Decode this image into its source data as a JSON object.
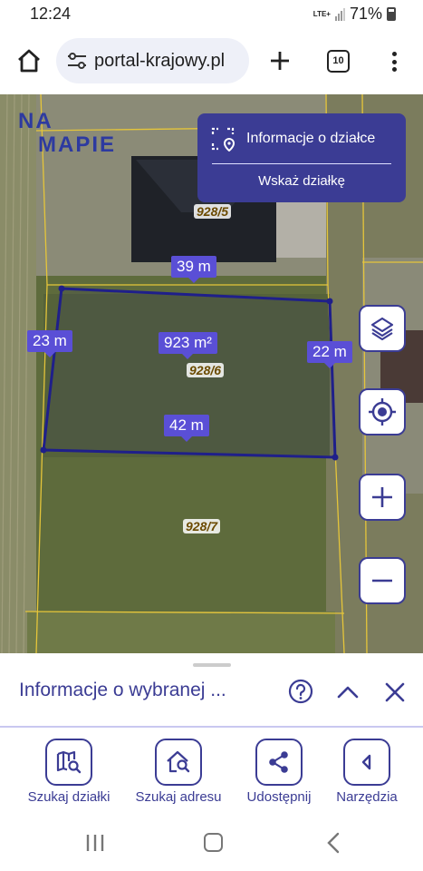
{
  "status_bar": {
    "time": "12:24",
    "network": "LTE+",
    "battery": "71%"
  },
  "browser": {
    "url": "portal-krajowy.pl",
    "tab_count": "10"
  },
  "map": {
    "logo_line1": "NA",
    "logo_line2": "MAPIE",
    "info_panel": {
      "title": "Informacje o działce",
      "action": "Wskaż działkę"
    },
    "parcels": [
      "928/5",
      "928/6",
      "928/7"
    ],
    "measurements": {
      "top": "39 m",
      "left": "23 m",
      "right": "22 m",
      "bottom": "42 m",
      "area": "923 m²"
    }
  },
  "sheet": {
    "title": "Informacje o wybranej ..."
  },
  "toolbar": [
    {
      "label": "Szukaj działki",
      "icon": "map-search-icon"
    },
    {
      "label": "Szukaj adresu",
      "icon": "home-search-icon"
    },
    {
      "label": "Udostępnij",
      "icon": "share-icon"
    },
    {
      "label": "Narzędzia",
      "icon": "tools-icon"
    }
  ],
  "colors": {
    "accent": "#3b3c94",
    "measure": "#5a4fd6",
    "parcel_line": "#1f1f8a"
  }
}
